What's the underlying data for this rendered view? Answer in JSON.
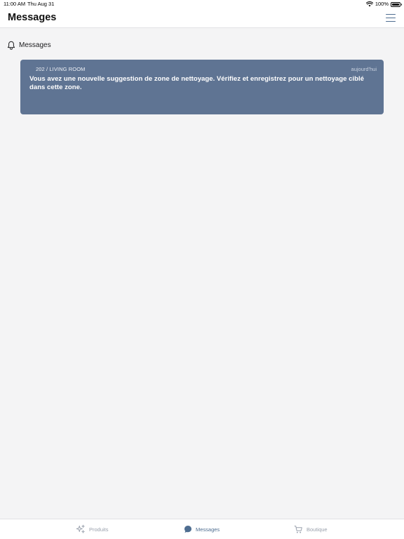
{
  "status_bar": {
    "time": "11:00 AM",
    "date": "Thu Aug 31",
    "battery": "100%",
    "battery_level": 1.0
  },
  "header": {
    "title": "Messages",
    "menu_icon": "hamburger-menu-icon"
  },
  "section": {
    "icon": "bell-icon",
    "title": "Messages"
  },
  "messages": [
    {
      "location": "202 / LIVING ROOM",
      "date": "aujourd'hui",
      "text": "Vous avez une nouvelle suggestion de zone de nettoyage. Vérifiez et enregistrez pour un nettoyage ciblé dans cette zone."
    }
  ],
  "tabs": [
    {
      "label": "Produits",
      "icon": "sparkles-icon",
      "active": false
    },
    {
      "label": "Messages",
      "icon": "chat-bubble-icon",
      "active": true
    },
    {
      "label": "Boutique",
      "icon": "cart-icon",
      "active": false
    }
  ],
  "colors": {
    "accent": "#4e6d90",
    "card_background": "#5f7493",
    "page_background": "#f4f4f5",
    "inactive_tab": "#9aa1ad"
  }
}
